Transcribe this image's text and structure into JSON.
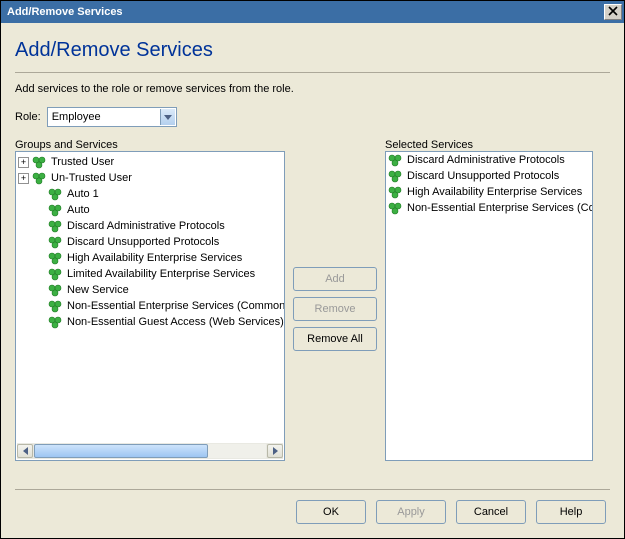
{
  "titlebar": {
    "title": "Add/Remove Services"
  },
  "header": {
    "title": "Add/Remove Services"
  },
  "description": "Add services to the role or remove services from the role.",
  "role": {
    "label": "Role:",
    "value": "Employee"
  },
  "left_panel_label": "Groups and Services",
  "right_panel_label": "Selected Services",
  "tree": {
    "items": [
      {
        "exp": "+",
        "indent": 0,
        "label": "Trusted User"
      },
      {
        "exp": "+",
        "indent": 0,
        "label": "Un-Trusted User"
      },
      {
        "exp": "",
        "indent": 1,
        "label": "Auto 1"
      },
      {
        "exp": "",
        "indent": 1,
        "label": "Auto"
      },
      {
        "exp": "",
        "indent": 1,
        "label": "Discard Administrative Protocols"
      },
      {
        "exp": "",
        "indent": 1,
        "label": "Discard Unsupported Protocols"
      },
      {
        "exp": "",
        "indent": 1,
        "label": "High Availability Enterprise Services"
      },
      {
        "exp": "",
        "indent": 1,
        "label": "Limited Availability Enterprise Services"
      },
      {
        "exp": "",
        "indent": 1,
        "label": "New Service"
      },
      {
        "exp": "",
        "indent": 1,
        "label": "Non-Essential Enterprise Services (Common)"
      },
      {
        "exp": "",
        "indent": 1,
        "label": "Non-Essential Guest Access (Web Services)"
      }
    ]
  },
  "selected": {
    "items": [
      "Discard Administrative Protocols",
      "Discard Unsupported Protocols",
      "High Availability Enterprise Services",
      "Non-Essential Enterprise Services (Co..."
    ]
  },
  "buttons": {
    "add": "Add",
    "remove": "Remove",
    "remove_all": "Remove All",
    "ok": "OK",
    "apply": "Apply",
    "cancel": "Cancel",
    "help": "Help"
  }
}
